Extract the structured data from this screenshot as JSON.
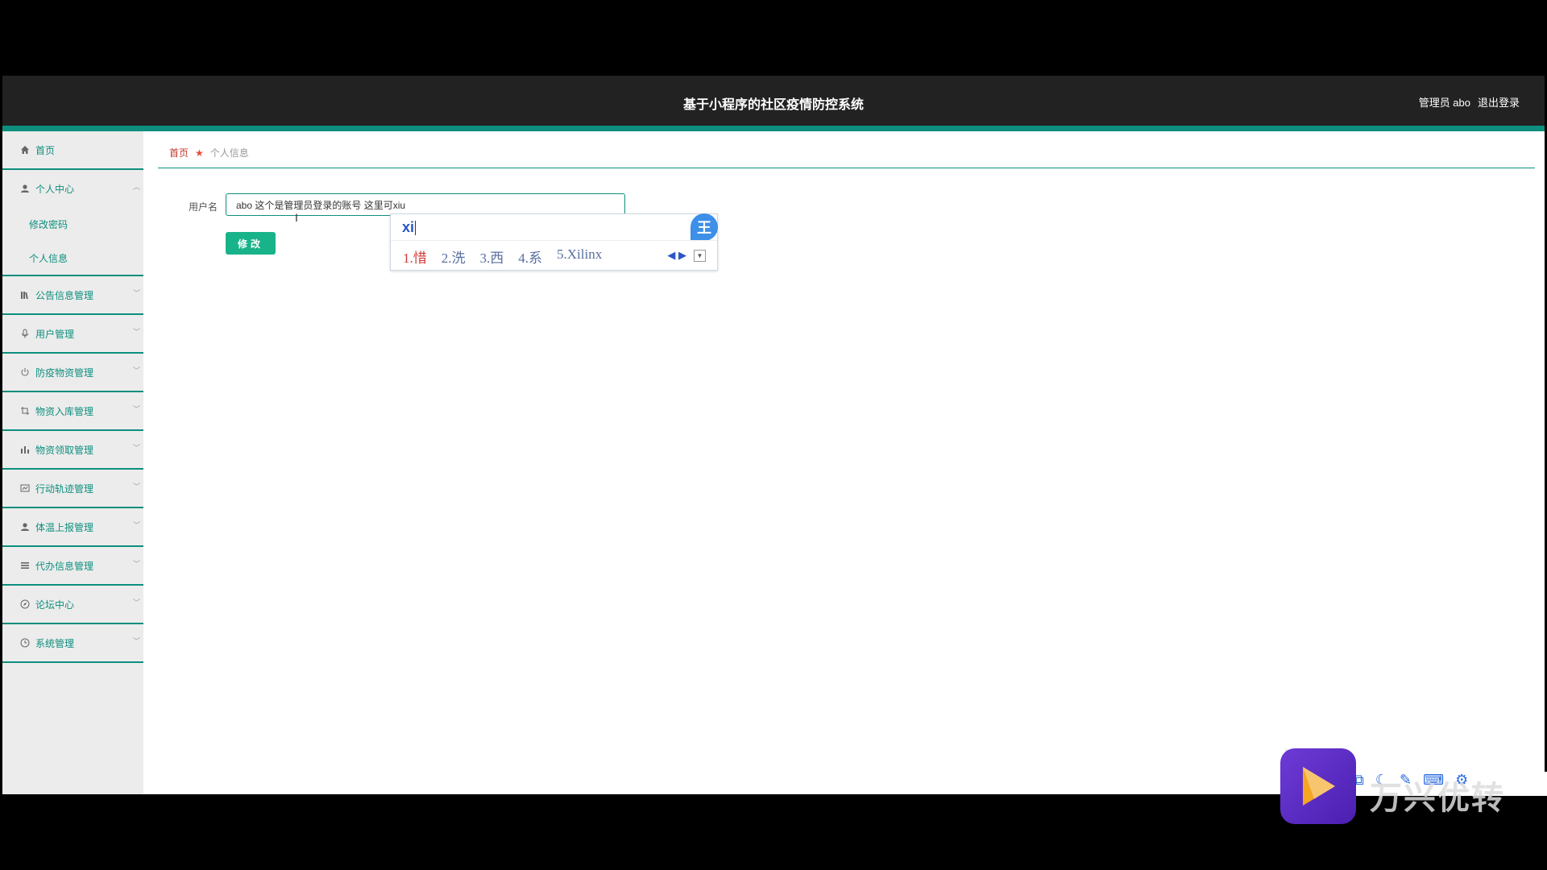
{
  "header": {
    "title": "基于小程序的社区疫情防控系统",
    "user": "管理员 abo",
    "logout": "退出登录"
  },
  "sidebar": {
    "items": [
      {
        "label": "首页",
        "icon": "home-icon"
      },
      {
        "label": "个人中心",
        "icon": "user-icon",
        "expanded": true,
        "children": [
          {
            "label": "修改密码"
          },
          {
            "label": "个人信息"
          }
        ]
      },
      {
        "label": "公告信息管理",
        "icon": "library-icon"
      },
      {
        "label": "用户管理",
        "icon": "microphone-icon"
      },
      {
        "label": "防疫物资管理",
        "icon": "power-icon"
      },
      {
        "label": "物资入库管理",
        "icon": "crop-icon"
      },
      {
        "label": "物资领取管理",
        "icon": "bar-chart-icon"
      },
      {
        "label": "行动轨迹管理",
        "icon": "line-chart-icon"
      },
      {
        "label": "体温上报管理",
        "icon": "user-icon"
      },
      {
        "label": "代办信息管理",
        "icon": "menu-icon"
      },
      {
        "label": "论坛中心",
        "icon": "compass-icon"
      },
      {
        "label": "系统管理",
        "icon": "clock-icon"
      }
    ]
  },
  "breadcrumb": {
    "home": "首页",
    "current": "个人信息"
  },
  "form": {
    "username_label": "用户名",
    "username_value": "abo 这个是管理员登录的账号 这里可xiu",
    "submit_label": "修改"
  },
  "ime": {
    "composition": "xi",
    "candidates": [
      "1.惜",
      "2.洗",
      "3.西",
      "4.系",
      "5.Xilinx"
    ],
    "logo": "王"
  },
  "watermark": {
    "text": "万兴优转"
  },
  "colors": {
    "accent": "#0e8f7e",
    "button": "#19b389",
    "topbar": "#222222"
  }
}
